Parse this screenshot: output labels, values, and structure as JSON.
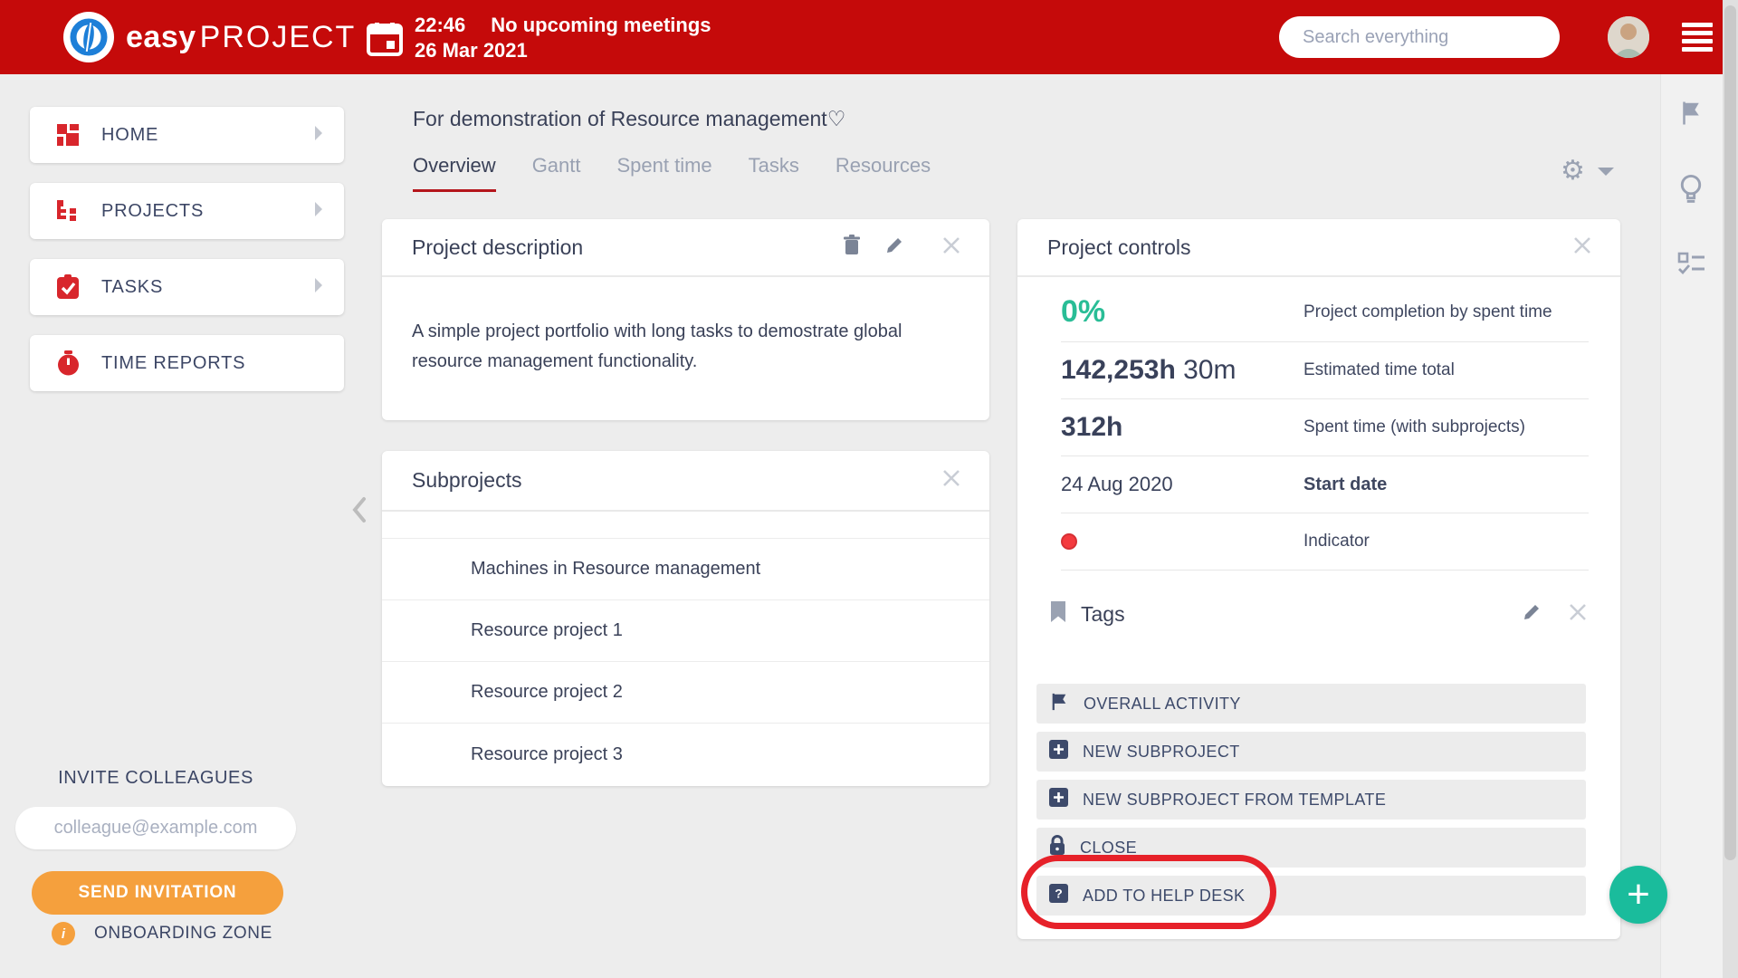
{
  "header": {
    "brand_easy": "easy",
    "brand_project": "PROJECT",
    "time": "22:46",
    "meetings": "No upcoming meetings",
    "date": "26 Mar 2021",
    "search_placeholder": "Search everything"
  },
  "sidebar": {
    "items": [
      {
        "label": "HOME"
      },
      {
        "label": "PROJECTS"
      },
      {
        "label": "TASKS"
      },
      {
        "label": "TIME REPORTS"
      }
    ],
    "invite": {
      "heading": "INVITE COLLEAGUES",
      "email_placeholder": "colleague@example.com",
      "send_button": "SEND INVITATION",
      "info_glyph": "i",
      "onboarding": "ONBOARDING ZONE"
    }
  },
  "main": {
    "project_title": "For demonstration of Resource management",
    "title_heart": "♡",
    "tabs": [
      {
        "label": "Overview"
      },
      {
        "label": "Gantt"
      },
      {
        "label": "Spent time"
      },
      {
        "label": "Tasks"
      },
      {
        "label": "Resources"
      }
    ],
    "description_card": {
      "title": "Project description",
      "body": "A simple project portfolio with long tasks to demostrate global resource management functionality."
    },
    "subprojects_card": {
      "title": "Subprojects",
      "items": [
        {
          "label": "Machines in Resource management"
        },
        {
          "label": "Resource project 1"
        },
        {
          "label": "Resource project 2"
        },
        {
          "label": "Resource project 3"
        }
      ]
    },
    "controls_card": {
      "title": "Project controls",
      "stats": [
        {
          "value": "0%",
          "label": "Project completion by spent time"
        },
        {
          "value": "142,253h",
          "suffix": " 30m",
          "label": "Estimated time total"
        },
        {
          "value": "312h",
          "label": "Spent time (with subprojects)"
        },
        {
          "value": "24 Aug 2020",
          "label": "Start date"
        },
        {
          "label": "Indicator"
        }
      ],
      "tags_title": "Tags",
      "actions": [
        {
          "label": "OVERALL ACTIVITY"
        },
        {
          "label": "NEW SUBPROJECT"
        },
        {
          "label": "NEW SUBPROJECT FROM TEMPLATE"
        },
        {
          "label": "CLOSE"
        },
        {
          "label": "ADD TO HELP DESK"
        }
      ]
    }
  },
  "fab_glyph": "+",
  "colors": {
    "header_red": "#c50a0a",
    "annotation_red": "#e62129",
    "tab_underline_red": "#b5161c",
    "icon_red": "#d8262c",
    "teal_percent": "#29bd96",
    "fab_green": "#1abc9c",
    "orange": "#f5a03d",
    "navy_text": "#3c4460",
    "indicator_red": "#f43a3e"
  }
}
